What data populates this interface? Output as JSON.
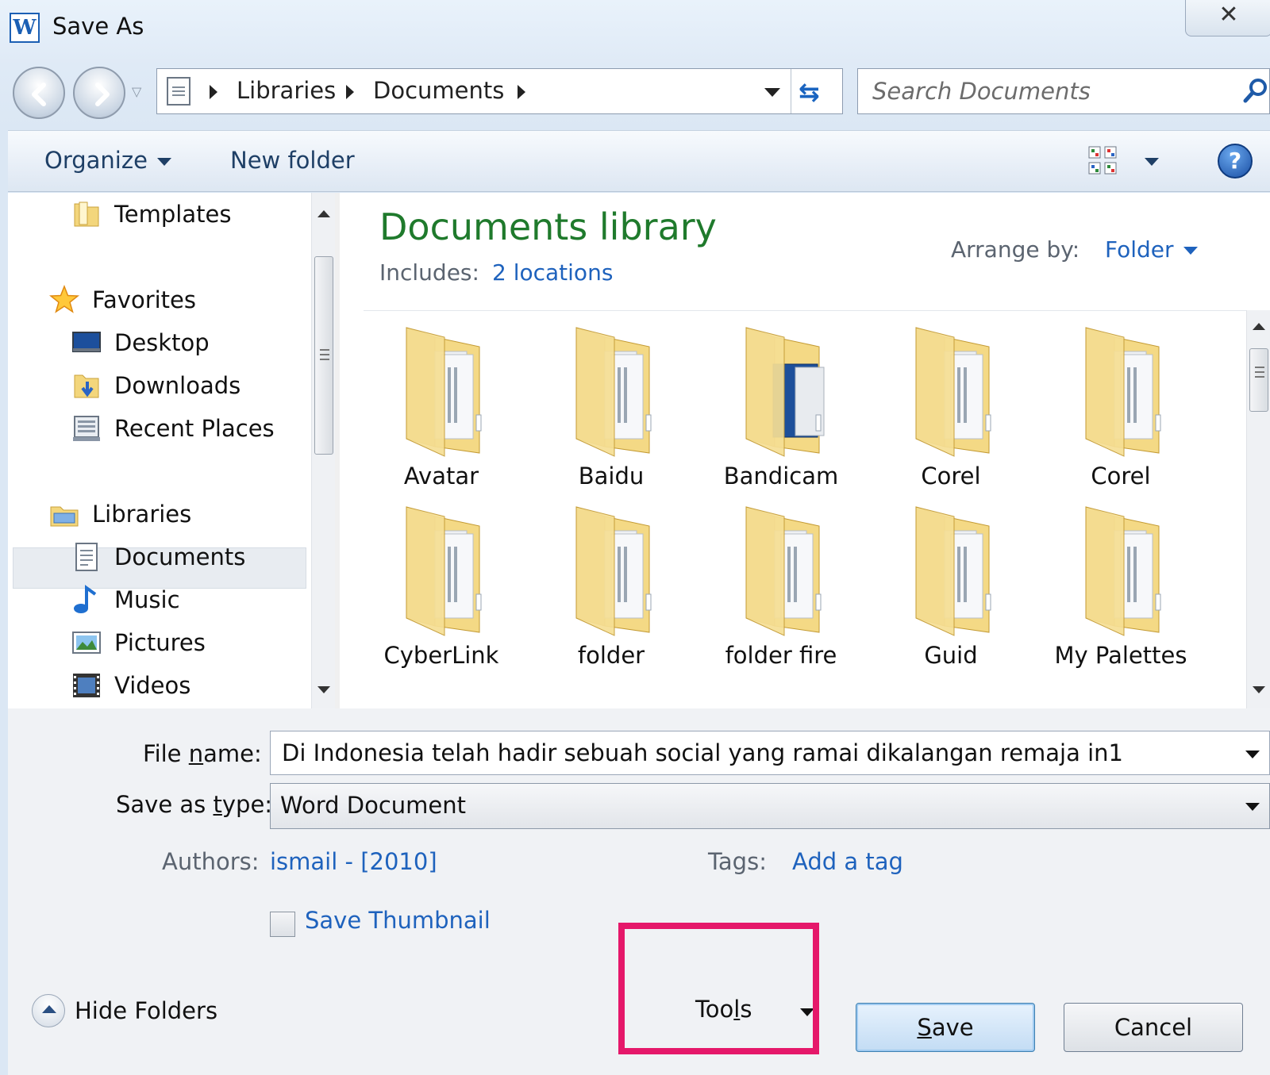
{
  "window": {
    "title": "Save As",
    "app_icon": "word-icon",
    "close_glyph": "✕"
  },
  "address_bar": {
    "breadcrumbs": [
      "Libraries",
      "Documents"
    ],
    "search_placeholder": "Search Documents"
  },
  "toolbar": {
    "organize_label": "Organize",
    "new_folder_label": "New folder",
    "help_glyph": "?"
  },
  "nav_pane": {
    "items": [
      {
        "label": "Templates",
        "icon": "folder-icon"
      },
      {
        "label": "Favorites",
        "icon": "star-icon"
      },
      {
        "label": "Desktop",
        "icon": "desktop-icon"
      },
      {
        "label": "Downloads",
        "icon": "downloads-icon"
      },
      {
        "label": "Recent Places",
        "icon": "recent-places-icon"
      },
      {
        "label": "Libraries",
        "icon": "libraries-icon"
      },
      {
        "label": "Documents",
        "icon": "documents-icon",
        "selected": true
      },
      {
        "label": "Music",
        "icon": "music-icon"
      },
      {
        "label": "Pictures",
        "icon": "pictures-icon"
      },
      {
        "label": "Videos",
        "icon": "videos-icon"
      }
    ]
  },
  "library": {
    "title": "Documents library",
    "includes_label": "Includes:",
    "includes_link": "2 locations",
    "arrange_label": "Arrange by:",
    "arrange_value": "Folder",
    "folders": [
      "Avatar",
      "Baidu",
      "Bandicam",
      "Corel",
      "Corel",
      "CyberLink",
      "folder",
      "folder fire",
      "Guid",
      "My Palettes"
    ]
  },
  "form": {
    "file_name_label_pre": "File ",
    "file_name_label_key": "n",
    "file_name_label_post": "ame:",
    "file_name_value": "Di Indonesia telah hadir sebuah social yang ramai dikalangan remaja in1",
    "save_type_label_pre": "Save as ",
    "save_type_label_key": "t",
    "save_type_label_post": "ype:",
    "save_type_value": "Word Document",
    "authors_label": "Authors:",
    "authors_value": "ismail - [2010]",
    "tags_label": "Tags:",
    "tags_value": "Add a tag",
    "save_thumbnail_label": "Save Thumbnail",
    "save_thumbnail_checked": false
  },
  "footer": {
    "hide_folders_label": "Hide Folders",
    "tools_label_pre": "Too",
    "tools_label_key": "l",
    "tools_label_post": "s",
    "save_label_key": "S",
    "save_label_post": "ave",
    "cancel_label": "Cancel"
  },
  "colors": {
    "highlight": "#e5186a",
    "link": "#1e62bd",
    "library_title": "#1f7a2c"
  }
}
